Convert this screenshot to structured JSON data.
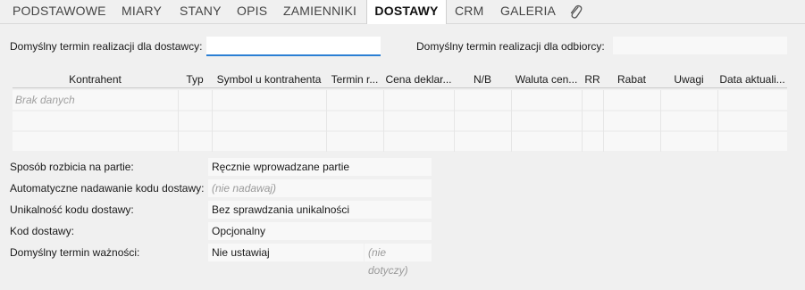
{
  "tabs": [
    {
      "label": "PODSTAWOWE"
    },
    {
      "label": "MIARY"
    },
    {
      "label": "STANY"
    },
    {
      "label": "OPIS"
    },
    {
      "label": "ZAMIENNIKI"
    },
    {
      "label": "DOSTAWY"
    },
    {
      "label": "CRM"
    },
    {
      "label": "GALERIA"
    }
  ],
  "attachment_icon": "paperclip-icon",
  "top_fields": {
    "supplier_term_label": "Domyślny termin realizacji dla dostawcy:",
    "supplier_term_value": "",
    "customer_term_label": "Domyślny termin realizacji dla odbiorcy:",
    "customer_term_value": ""
  },
  "grid": {
    "columns": [
      "Kontrahent",
      "Typ",
      "Symbol u kontrahenta",
      "Termin r...",
      "Cena deklar...",
      "N/B",
      "Waluta cen...",
      "RR",
      "Rabat",
      "Uwagi",
      "Data aktuali..."
    ],
    "empty_text": "Brak danych"
  },
  "form": {
    "split_label": "Sposób rozbicia na partie:",
    "split_value": "Ręcznie wprowadzane partie",
    "autocode_label": "Automatyczne nadawanie kodu dostawy:",
    "autocode_value": "(nie nadawaj)",
    "unique_label": "Unikalność kodu dostawy:",
    "unique_value": "Bez sprawdzania unikalności",
    "code_label": "Kod dostawy:",
    "code_value": "Opcjonalny",
    "expiry_label": "Domyślny termin ważności:",
    "expiry_value": "Nie ustawiaj",
    "expiry_extra": "(nie dotyczy)"
  },
  "colors": {
    "accent": "#2b7fd4",
    "background": "#f0f0f0",
    "field": "#f8f8f8"
  }
}
